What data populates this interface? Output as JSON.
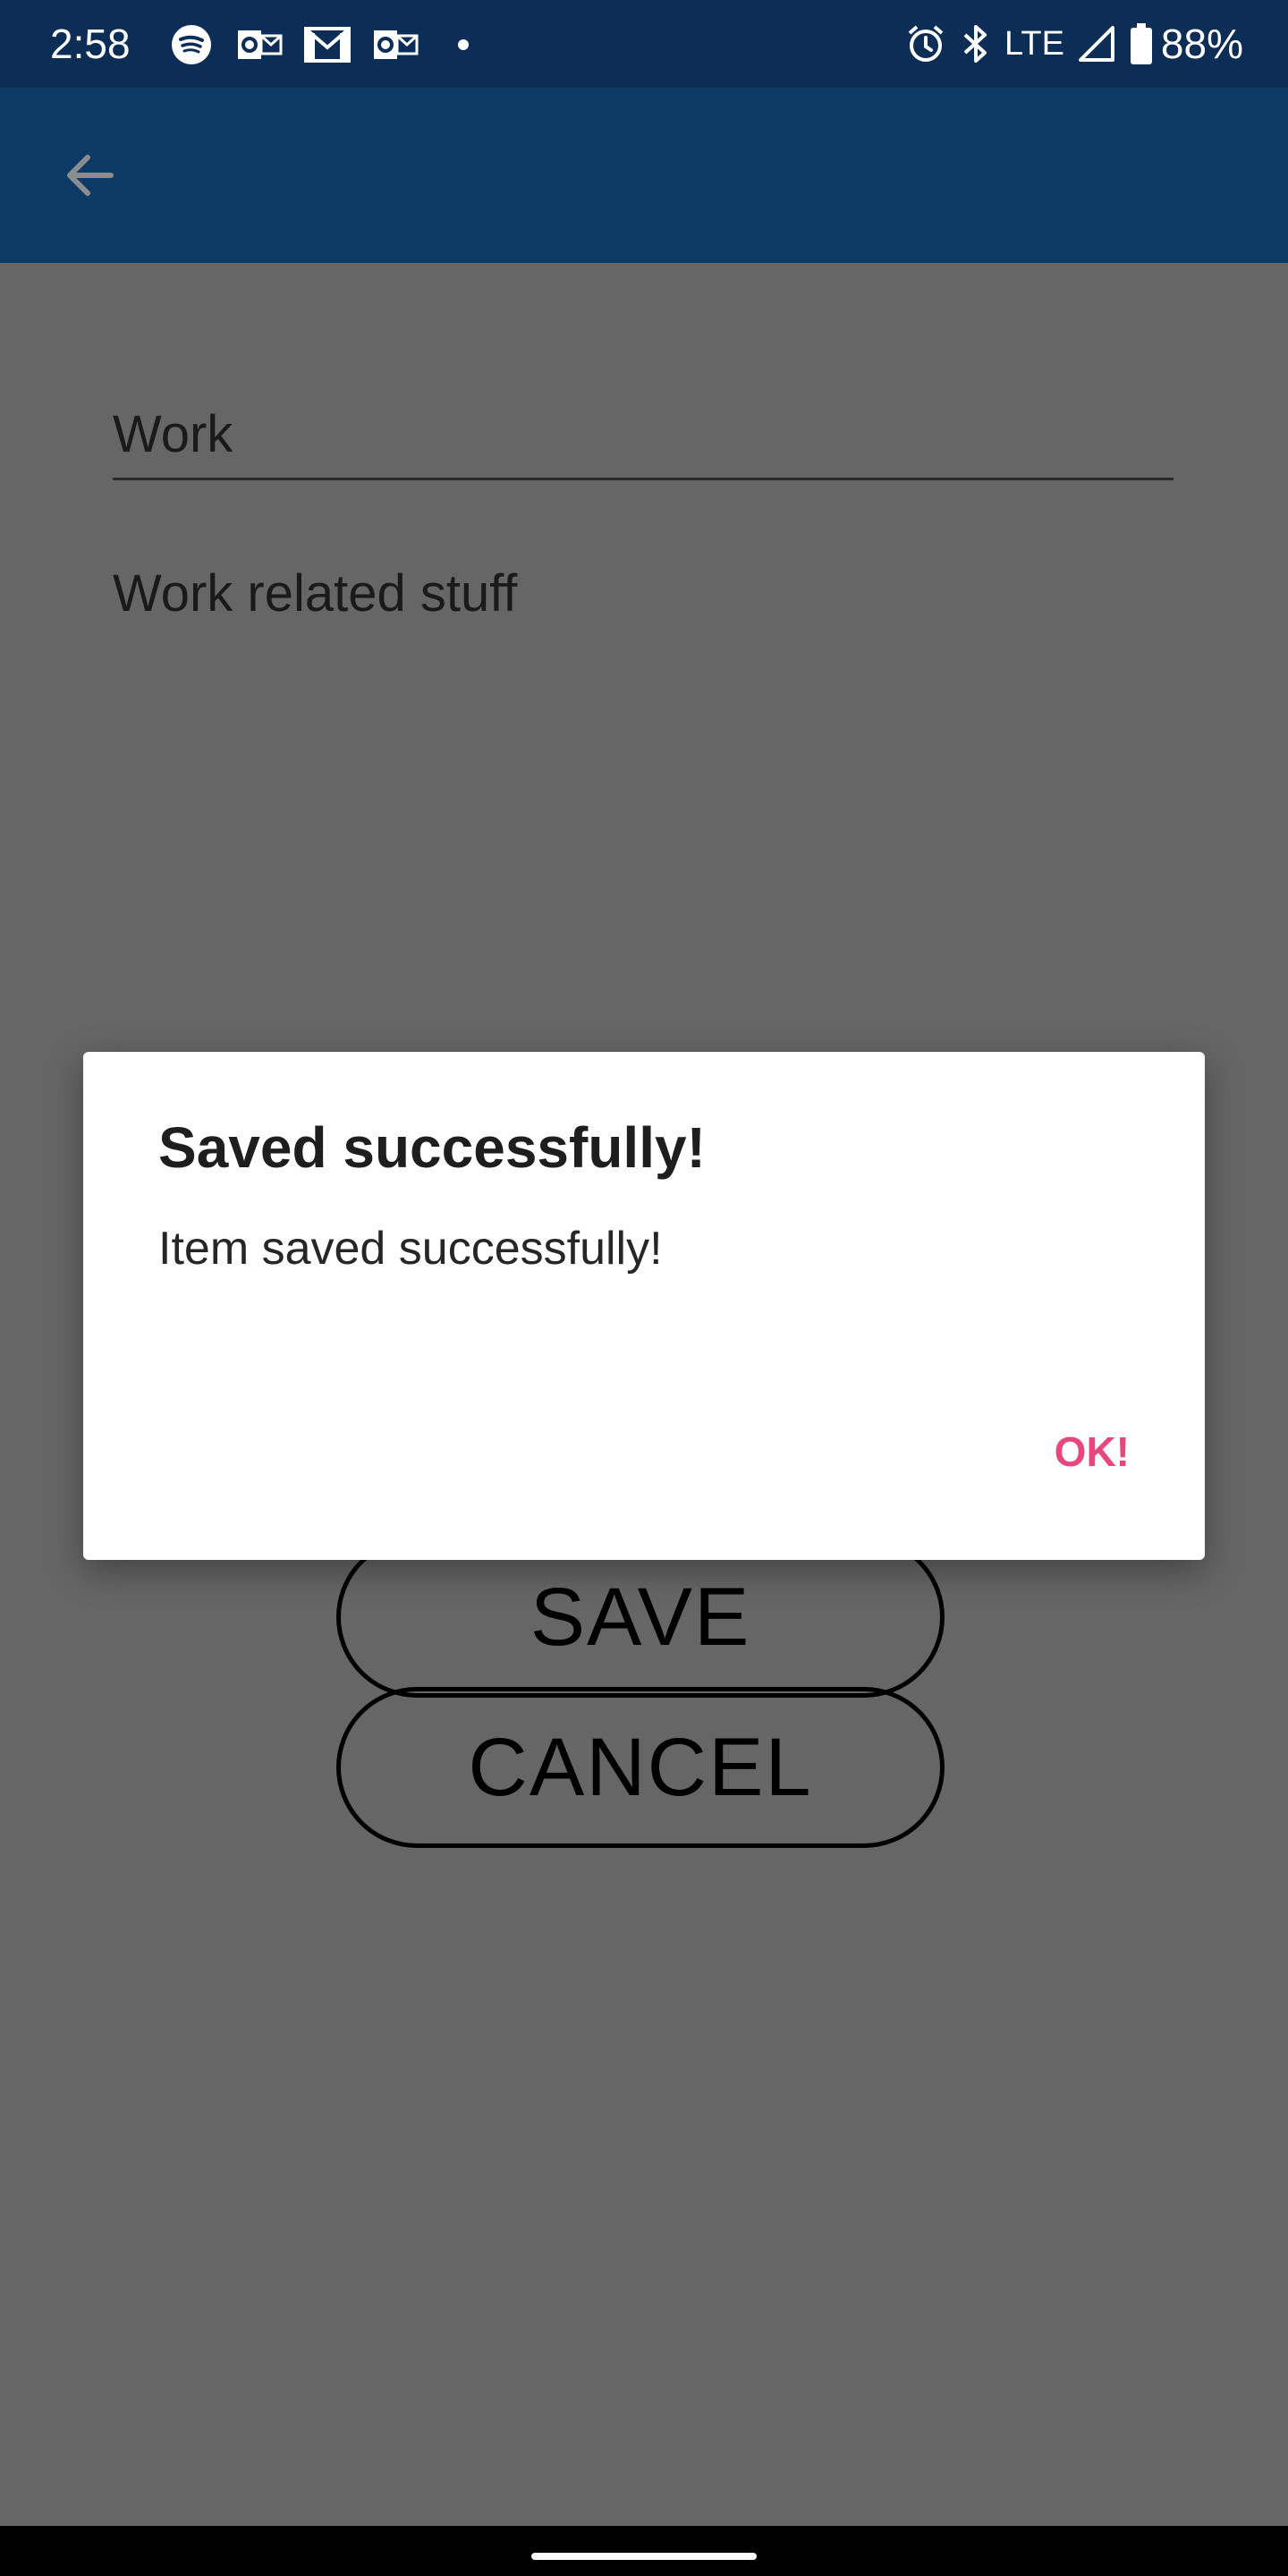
{
  "status_bar": {
    "time": "2:58",
    "left_icons": [
      "spotify-icon",
      "outlook-icon",
      "gmail-icon",
      "outlook-icon",
      "dot-icon"
    ],
    "right_icons": [
      "alarm-icon",
      "bluetooth-icon",
      "signal-icon",
      "battery-icon"
    ],
    "network_label": "LTE",
    "battery_label": "88%"
  },
  "app_bar": {
    "back_icon": "arrow-back-icon",
    "color": "#0e3b66"
  },
  "form": {
    "name_value": "Work",
    "description_value": "Work related stuff",
    "save_label": "SAVE",
    "cancel_label": "CANCEL"
  },
  "dialog": {
    "title": "Saved successfully!",
    "message": "Item saved successfully!",
    "ok_label": "OK!",
    "accent_color": "#e8467f"
  }
}
